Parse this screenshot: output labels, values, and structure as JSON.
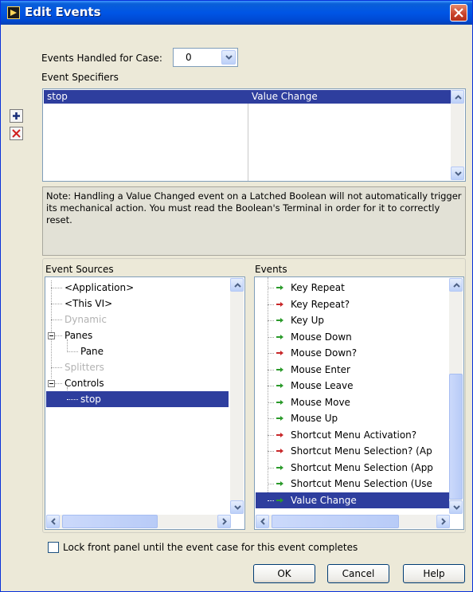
{
  "window": {
    "title": "Edit Events"
  },
  "events_handled": {
    "label": "Events Handled for Case:",
    "value": "0"
  },
  "event_specifiers": {
    "label": "Event Specifiers",
    "rows": [
      {
        "source": "stop",
        "event": "Value Change"
      }
    ]
  },
  "note": "Note:  Handling a Value Changed event on a Latched Boolean will not automatically trigger its mechanical action. You must read the Boolean's Terminal in order for it to correctly reset.",
  "event_sources": {
    "label": "Event Sources",
    "items": [
      "<Application>",
      "<This VI>",
      "Dynamic",
      "Panes",
      "Pane",
      "Splitters",
      "Controls",
      "stop"
    ],
    "selected": "stop"
  },
  "events": {
    "label": "Events",
    "items": [
      "Key Repeat",
      "Key Repeat?",
      "Key Up",
      "Mouse Down",
      "Mouse Down?",
      "Mouse Enter",
      "Mouse Leave",
      "Mouse Move",
      "Mouse Up",
      "Shortcut Menu Activation?",
      "Shortcut Menu Selection? (Ap",
      "Shortcut Menu Selection (App",
      "Shortcut Menu Selection (Use",
      "Value Change"
    ],
    "selected": "Value Change"
  },
  "lock_panel": {
    "label": "Lock front panel until the event case for this event completes",
    "checked": false
  },
  "buttons": {
    "ok": "OK",
    "cancel": "Cancel",
    "help": "Help"
  },
  "colors": {
    "selection": "#2e3e9e",
    "titlebar": "#0055e5",
    "notify_arrow": "#2a9a2a",
    "filter_arrow": "#c8282a"
  }
}
